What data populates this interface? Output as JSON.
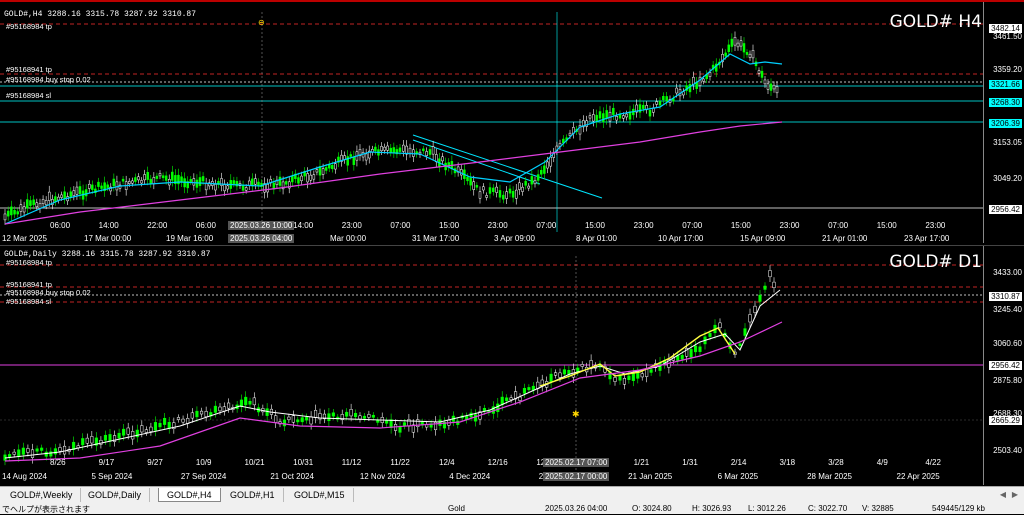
{
  "chart1": {
    "symbol_header": "GOLD#,H4  3288.16 3315.78 3287.92 3310.87",
    "big_label": "GOLD# H4",
    "orders": [
      "#95168984 tp",
      "#95168941 tp",
      "#95168984 buy stop 0.02",
      "#95168984 sl"
    ],
    "price_labels": [
      "3461.50",
      "3359.20",
      "3153.05",
      "3049.20"
    ],
    "tags": [
      {
        "text": "3482.14",
        "bg": "#ffffff",
        "fg": "#000000"
      },
      {
        "text": "3321.66",
        "bg": "#00ffff",
        "fg": "#000000"
      },
      {
        "text": "3268.30",
        "bg": "#00ffff",
        "fg": "#000000"
      },
      {
        "text": "3206.39",
        "bg": "#00ffff",
        "fg": "#000000"
      },
      {
        "text": "2956.42",
        "bg": "#ffffff",
        "fg": "#000000"
      }
    ],
    "time_labels": [
      "12 Mar 2025",
      "17 Mar 00:00",
      "19 Mar 16:00",
      "24 M",
      "Mar 00:00",
      "31 Mar 17:00",
      "3 Apr 09:00",
      "8 Apr 01:00",
      "10 Apr 17:00",
      "15 Apr 09:00",
      "21 Apr 01:00",
      "23 Apr 17:00"
    ],
    "time_labels_top": [
      "06:00",
      "14:00",
      "22:00",
      "06:00",
      "14:00",
      "14:00",
      "23:00",
      "07:00",
      "15:00",
      "23:00",
      "07:00",
      "15:00",
      "23:00",
      "07:00",
      "15:00",
      "23:00",
      "07:00",
      "15:00",
      "23:00"
    ],
    "cross_top": "2025.03.26 10:00",
    "cross_bottom": "2025.03.26 04:00"
  },
  "chart2": {
    "symbol_header": "GOLD#,Daily  3288.16 3315.78 3287.92 3310.87",
    "big_label": "GOLD# D1",
    "orders": [
      "#95168984 tp",
      "#95168941 tp",
      "#95168984 buy stop 0.02",
      "#95168984 sl"
    ],
    "price_labels": [
      "3433.00",
      "3245.40",
      "3060.60",
      "2875.80",
      "2688.30",
      "2503.40"
    ],
    "tags": [
      {
        "text": "3310.87",
        "bg": "#ffffff",
        "fg": "#000000"
      },
      {
        "text": "2956.42",
        "bg": "#ffffff",
        "fg": "#000000"
      },
      {
        "text": "2665.29",
        "bg": "#ffffff",
        "fg": "#000000"
      }
    ],
    "time_labels": [
      "14 Aug 2024",
      "5 Sep 2024",
      "27 Sep 2024",
      "21 Oct 2024",
      "12 Nov 2024",
      "4 Dec 2024",
      "27 Dec 2024",
      "21 Jan 2025",
      "6 Mar 2025",
      "28 Mar 2025",
      "22 Apr 2025"
    ],
    "time_labels_top": [
      "8/26",
      "9/17",
      "9/27",
      "10/9",
      "10/21",
      "10/31",
      "11/12",
      "11/22",
      "12/4",
      "12/16",
      "12/27",
      "1/9",
      "1/21",
      "1/31",
      "2/14",
      "3/18",
      "3/28",
      "4/9",
      "4/22"
    ],
    "cross_bottom": "2025.02.17 00:00",
    "cross_top": "2025.02.17 07:00"
  },
  "tabs": [
    "GOLD#,Weekly",
    "GOLD#,Daily",
    "GOLD#,H4",
    "GOLD#,H1",
    "GOLD#,M15"
  ],
  "status": {
    "help": "でヘルプが表示されます",
    "symbol": "Gold",
    "datetime": "2025.03.26 04:00",
    "open": "O: 3024.80",
    "high": "H: 3026.93",
    "low": "L: 3012.26",
    "close": "C: 3022.70",
    "volume": "V: 32885",
    "traffic": "549445/129 kb"
  },
  "colors": {
    "ma_fast": "#00d0ff",
    "ma_slow": "#e040e0",
    "trend": "#00e5ff",
    "yellow_ma": "#ffff40",
    "bull": "#00ff00"
  }
}
